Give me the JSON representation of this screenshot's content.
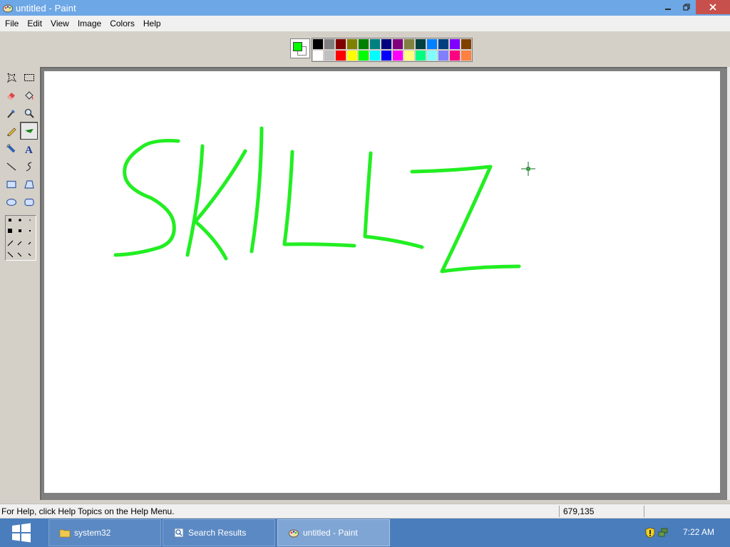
{
  "window": {
    "title": "untitled - Paint"
  },
  "menu": {
    "items": [
      "File",
      "Edit",
      "View",
      "Image",
      "Colors",
      "Help"
    ]
  },
  "palette": {
    "foreground": "#00ff00",
    "background": "#ffffff",
    "row1": [
      "#000000",
      "#808080",
      "#800000",
      "#808000",
      "#008000",
      "#008080",
      "#000080",
      "#800080",
      "#808040",
      "#004040",
      "#0080ff",
      "#004080",
      "#8000ff",
      "#804000"
    ],
    "row2": [
      "#ffffff",
      "#c0c0c0",
      "#ff0000",
      "#ffff00",
      "#00ff00",
      "#00ffff",
      "#0000ff",
      "#ff00ff",
      "#ffff80",
      "#00ff80",
      "#80ffff",
      "#8080ff",
      "#ff0080",
      "#ff8040"
    ]
  },
  "toolbox": {
    "tools": [
      "free-form-select-icon",
      "select-icon",
      "eraser-icon",
      "fill-icon",
      "pick-color-icon",
      "magnifier-icon",
      "pencil-icon",
      "brush-icon",
      "airbrush-icon",
      "text-icon",
      "line-icon",
      "curve-icon",
      "rectangle-icon",
      "polygon-icon",
      "ellipse-icon",
      "rounded-rectangle-icon"
    ],
    "selected": "brush-icon"
  },
  "canvas": {
    "stroke_color": "#22ee22"
  },
  "statusbar": {
    "help_text": "For Help, click Help Topics on the Help Menu.",
    "coords": "679,135"
  },
  "taskbar": {
    "buttons": [
      {
        "label": "system32",
        "icon": "folder-icon"
      },
      {
        "label": "Search Results",
        "icon": "search-results-icon"
      },
      {
        "label": "untitled - Paint",
        "icon": "paint-icon"
      }
    ],
    "clock": "7:22 AM"
  }
}
